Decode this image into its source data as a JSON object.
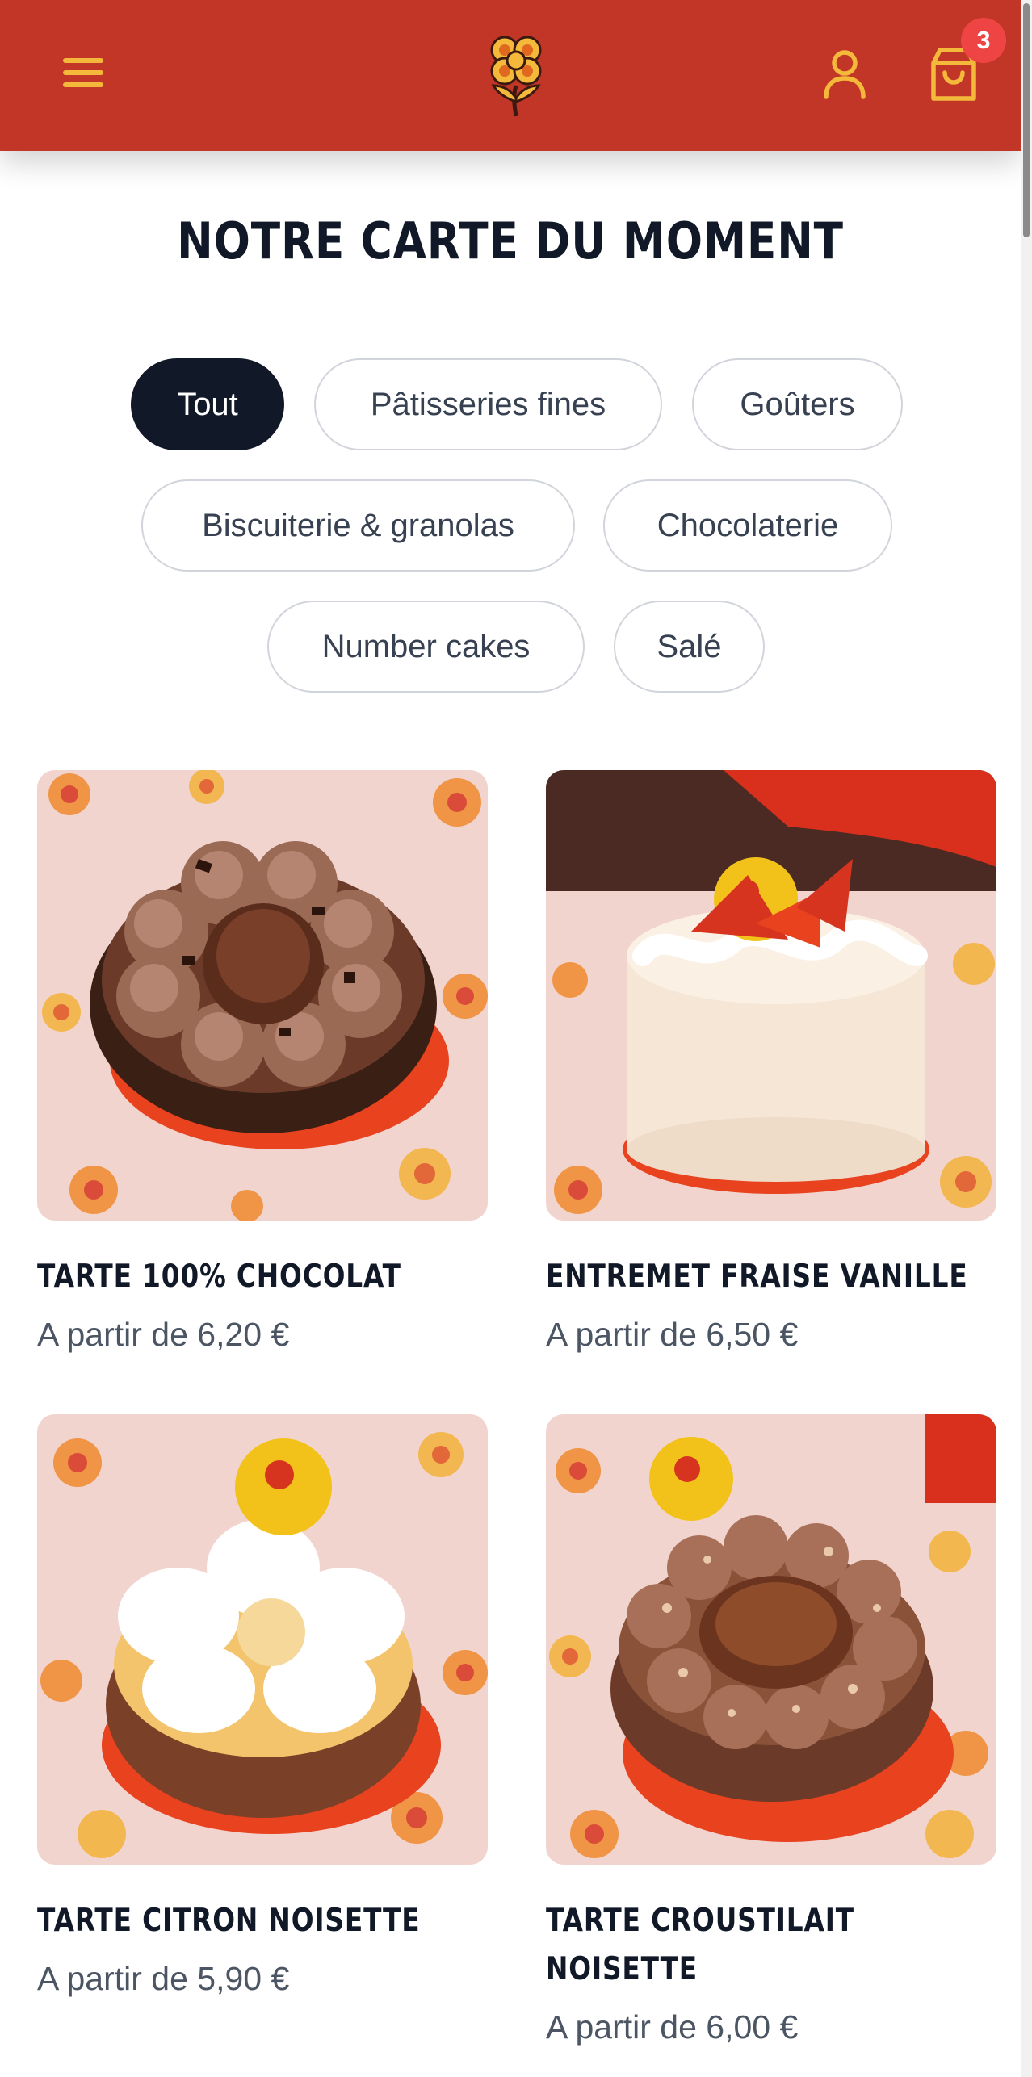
{
  "header": {
    "menu_icon": "hamburger-menu-icon",
    "logo_icon": "flower-logo-icon",
    "account_icon": "user-icon",
    "cart_icon": "shopping-bag-icon",
    "cart_count": "3",
    "colors": {
      "background": "#c13626",
      "icons": "#f4b93b",
      "badge": "#ef4444"
    }
  },
  "main": {
    "title": "NOTRE CARTE DU MOMENT",
    "filters": [
      {
        "label": "Tout",
        "active": true
      },
      {
        "label": "Pâtisseries fines",
        "active": false
      },
      {
        "label": "Goûters",
        "active": false
      },
      {
        "label": "Biscuiterie & granolas",
        "active": false
      },
      {
        "label": "Chocolaterie",
        "active": false
      },
      {
        "label": "Number cakes",
        "active": false
      },
      {
        "label": "Salé",
        "active": false
      }
    ],
    "products": [
      {
        "name": "TARTE 100% CHOCOLAT",
        "price": "A partir de 6,20 €"
      },
      {
        "name": "ENTREMET FRAISE VANILLE",
        "price": "A partir de 6,50 €"
      },
      {
        "name": "TARTE CITRON NOISETTE",
        "price": "A partir de 5,90 €"
      },
      {
        "name": "TARTE CROUSTILAIT NOISETTE",
        "price": "A partir de 6,00 €"
      }
    ]
  }
}
